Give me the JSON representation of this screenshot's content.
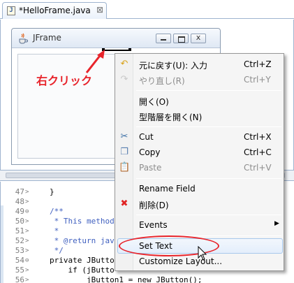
{
  "tab": {
    "title": "*HelloFrame.java",
    "close": "⊠",
    "icon_label": "J"
  },
  "jframe": {
    "title": "JFrame",
    "close_glyph": "x"
  },
  "annotation": {
    "text": "右クリック"
  },
  "code": {
    "lines": [
      {
        "num": "47",
        "fold": ">",
        "text": "}",
        "kind": "plain"
      },
      {
        "num": "48",
        "fold": ">",
        "text": "",
        "kind": "plain"
      },
      {
        "num": "49",
        "fold": "⊖",
        "text": "/**",
        "kind": "comment"
      },
      {
        "num": "50",
        "fold": ">",
        "text": " * This method",
        "kind": "comment"
      },
      {
        "num": "51",
        "fold": ">",
        "text": " * ",
        "kind": "comment"
      },
      {
        "num": "52",
        "fold": ">",
        "text": " * @return jav",
        "kind": "comment"
      },
      {
        "num": "53",
        "fold": ">",
        "text": " */",
        "kind": "comment"
      },
      {
        "num": "54",
        "fold": "⊖",
        "text": "private JButton",
        "kind": "code"
      },
      {
        "num": "55",
        "fold": ">",
        "text": "    if (jButto",
        "kind": "code"
      },
      {
        "num": "56",
        "fold": ">",
        "text": "        jButton1 = new JButton();",
        "kind": "code"
      }
    ]
  },
  "menu": {
    "items": [
      {
        "id": "undo",
        "label": "元に戻す(U): 入力",
        "shortcut": "Ctrl+Z",
        "icon": "undo-icon",
        "glyph": "↶",
        "color": "#d9a31b",
        "disabled": false
      },
      {
        "id": "redo",
        "label": "やり直し(R)",
        "shortcut": "Ctrl+Y",
        "icon": "redo-icon",
        "glyph": "↷",
        "color": "#c8c8c8",
        "disabled": true
      },
      {
        "id": "open",
        "label": "開く(O)",
        "shortcut": "",
        "disabled": false
      },
      {
        "id": "open-type-hierarchy",
        "label": "型階層を開く(N)",
        "shortcut": "",
        "disabled": false
      },
      {
        "id": "cut",
        "label": "Cut",
        "shortcut": "Ctrl+X",
        "icon": "scissors-icon",
        "glyph": "✂",
        "color": "#3a6ea5",
        "disabled": false
      },
      {
        "id": "copy",
        "label": "Copy",
        "shortcut": "Ctrl+C",
        "icon": "copy-icon",
        "glyph": "❐",
        "color": "#5a7fb0",
        "disabled": false
      },
      {
        "id": "paste",
        "label": "Paste",
        "shortcut": "Ctrl+V",
        "icon": "paste-icon",
        "glyph": "📋",
        "color": "#b0b0b0",
        "disabled": true
      },
      {
        "id": "rename-field",
        "label": "Rename Field",
        "shortcut": "",
        "disabled": false
      },
      {
        "id": "delete",
        "label": "削除(D)",
        "shortcut": "",
        "icon": "delete-icon",
        "glyph": "✖",
        "color": "#e02424",
        "disabled": false
      },
      {
        "id": "events",
        "label": "Events",
        "shortcut": "",
        "submenu": "▶",
        "disabled": false
      },
      {
        "id": "set-text",
        "label": "Set Text",
        "shortcut": "",
        "disabled": false,
        "hover": true
      },
      {
        "id": "customize-layout",
        "label": "Customize Layout...",
        "shortcut": "",
        "disabled": false
      }
    ]
  },
  "colors": {
    "accent_red": "#e8242b",
    "menu_hover_border": "#a8c8ec"
  }
}
